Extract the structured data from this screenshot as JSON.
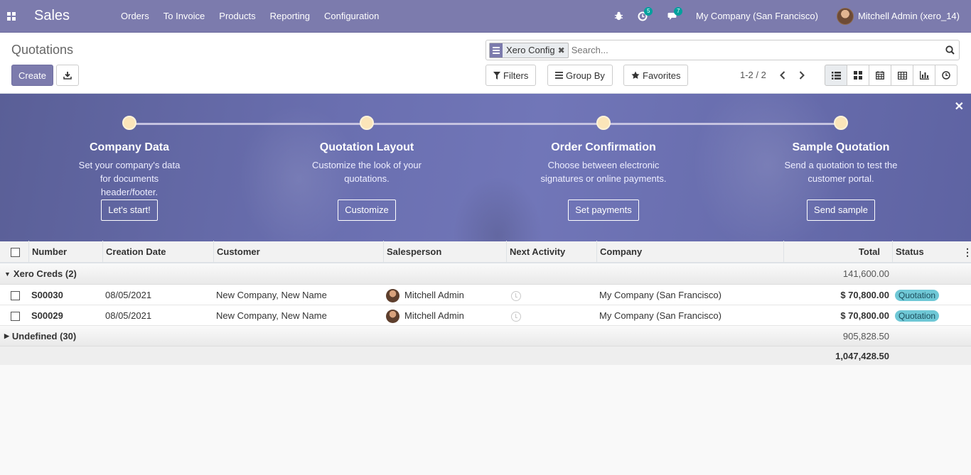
{
  "navbar": {
    "app_name": "Sales",
    "menu": [
      "Orders",
      "To Invoice",
      "Products",
      "Reporting",
      "Configuration"
    ],
    "activity_count": "5",
    "messages_count": "7",
    "company": "My Company (San Francisco)",
    "user": "Mitchell Admin (xero_14)"
  },
  "control_panel": {
    "title": "Quotations",
    "create_label": "Create",
    "facet_label": "Xero Config",
    "search_placeholder": "Search...",
    "filters_label": "Filters",
    "group_by_label": "Group By",
    "favorites_label": "Favorites",
    "pager_value": "1-2 / 2"
  },
  "banner": {
    "steps": [
      {
        "title": "Company Data",
        "desc": "Set your company's data for documents header/footer.",
        "button": "Let's start!"
      },
      {
        "title": "Quotation Layout",
        "desc": "Customize the look of your quotations.",
        "button": "Customize"
      },
      {
        "title": "Order Confirmation",
        "desc": "Choose between electronic signatures or online payments.",
        "button": "Set payments"
      },
      {
        "title": "Sample Quotation",
        "desc": "Send a quotation to test the customer portal.",
        "button": "Send sample"
      }
    ]
  },
  "table": {
    "columns": [
      "Number",
      "Creation Date",
      "Customer",
      "Salesperson",
      "Next Activity",
      "Company",
      "Total",
      "Status"
    ],
    "groups": [
      {
        "label": "Xero Creds (2)",
        "total": "141,600.00",
        "rows": [
          {
            "number": "S00030",
            "date": "08/05/2021",
            "customer": "New Company, New Name",
            "salesperson": "Mitchell Admin",
            "company": "My Company (San Francisco)",
            "total": "$ 70,800.00",
            "status": "Quotation"
          },
          {
            "number": "S00029",
            "date": "08/05/2021",
            "customer": "New Company, New Name",
            "salesperson": "Mitchell Admin",
            "company": "My Company (San Francisco)",
            "total": "$ 70,800.00",
            "status": "Quotation"
          }
        ]
      },
      {
        "label": "Undefined (30)",
        "total": "905,828.50"
      }
    ],
    "grand_total": "1,047,428.50"
  },
  "colors": {
    "brand": "#7c7bad",
    "badge": "#00a09d",
    "status": "#6fc8d6"
  }
}
